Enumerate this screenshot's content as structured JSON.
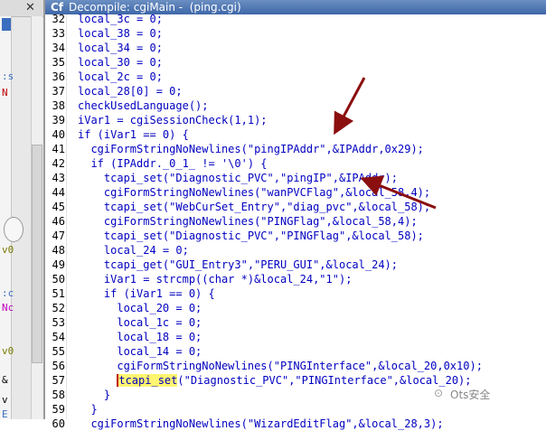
{
  "window": {
    "title": "Decompile: cgiMain -  (ping.cgi)",
    "title_icon": "ghidra-decompile-icon"
  },
  "left_panel": {
    "fragments": [
      ":s",
      "N",
      "v0",
      ":c",
      "Nc",
      "v0",
      "&",
      "v",
      "E"
    ]
  },
  "code_lines": [
    {
      "ln": "32",
      "text": "local_3c = 0;"
    },
    {
      "ln": "33",
      "text": "local_38 = 0;"
    },
    {
      "ln": "34",
      "text": "local_34 = 0;"
    },
    {
      "ln": "35",
      "text": "local_30 = 0;"
    },
    {
      "ln": "36",
      "text": "local_2c = 0;"
    },
    {
      "ln": "37",
      "text": "local_28[0] = 0;"
    },
    {
      "ln": "38",
      "text": "checkUsedLanguage();"
    },
    {
      "ln": "39",
      "text": "iVar1 = cgiSessionCheck(1,1);"
    },
    {
      "ln": "40",
      "text": "if (iVar1 == 0) {"
    },
    {
      "ln": "41",
      "text": "  cgiFormStringNoNewlines(\"pingIPAddr\",&IPAddr,0x29);"
    },
    {
      "ln": "42",
      "text": "  if (IPAddr._0_1_ != '\\0') {"
    },
    {
      "ln": "43",
      "text": "    tcapi_set(\"Diagnostic_PVC\",\"pingIP\",&IPAddr);"
    },
    {
      "ln": "44",
      "text": "    cgiFormStringNoNewlines(\"wanPVCFlag\",&local_58,4);"
    },
    {
      "ln": "45",
      "text": "    tcapi_set(\"WebCurSet_Entry\",\"diag_pvc\",&local_58);"
    },
    {
      "ln": "46",
      "text": "    cgiFormStringNoNewlines(\"PINGFlag\",&local_58,4);"
    },
    {
      "ln": "47",
      "text": "    tcapi_set(\"Diagnostic_PVC\",\"PINGFlag\",&local_58);"
    },
    {
      "ln": "48",
      "text": "    local_24 = 0;"
    },
    {
      "ln": "49",
      "text": "    tcapi_get(\"GUI_Entry3\",\"PERU_GUI\",&local_24);"
    },
    {
      "ln": "50",
      "text": "    iVar1 = strcmp((char *)&local_24,\"1\");"
    },
    {
      "ln": "51",
      "text": "    if (iVar1 == 0) {"
    },
    {
      "ln": "52",
      "text": "      local_20 = 0;"
    },
    {
      "ln": "53",
      "text": "      local_1c = 0;"
    },
    {
      "ln": "54",
      "text": "      local_18 = 0;"
    },
    {
      "ln": "55",
      "text": "      local_14 = 0;"
    },
    {
      "ln": "56",
      "text": "      cgiFormStringNoNewlines(\"PINGInterface\",&local_20,0x10);"
    },
    {
      "ln": "57",
      "text": "      tcapi_set(\"Diagnostic_PVC\",\"PINGInterface\",&local_20);"
    },
    {
      "ln": "58",
      "text": "    }"
    },
    {
      "ln": "59",
      "text": "  }"
    },
    {
      "ln": "60",
      "text": "  cgiFormStringNoNewlines(\"WizardEditFlag\",&local_28,3);"
    }
  ],
  "cursor_line": "57",
  "annotation_arrow_color": "#8b0f0f",
  "watermark": "Ots安全",
  "colors": {
    "code_text": "#0000c0",
    "line_numbers": "#000000",
    "title_bar": "#4a72b0",
    "cursor_highlight": "#fff570"
  }
}
